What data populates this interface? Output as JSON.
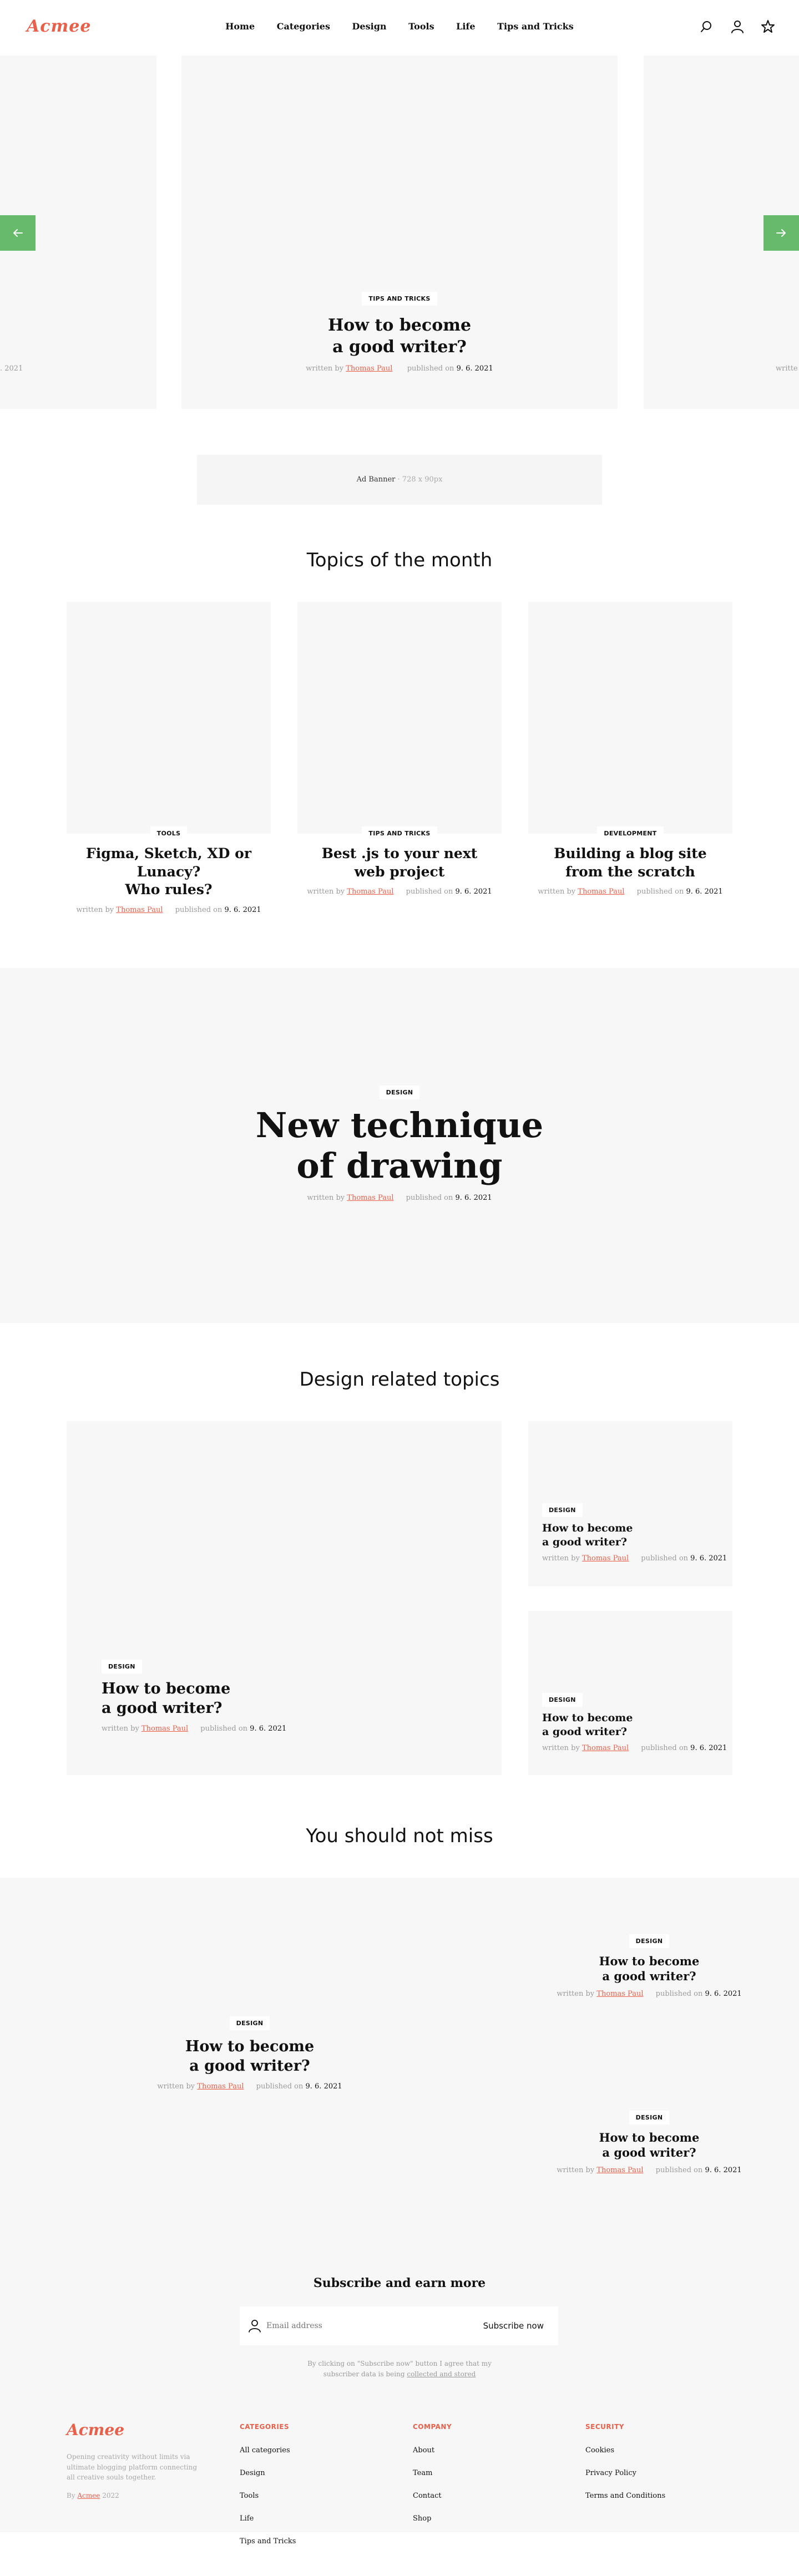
{
  "header": {
    "logo": "Acmee",
    "nav": [
      "Home",
      "Categories",
      "Design",
      "Tools",
      "Life",
      "Tips and Tricks"
    ]
  },
  "hero": {
    "tag": "TIPS AND TRICKS",
    "title_line1": "How to become",
    "title_line2": "a good writer?",
    "written_by": "written by",
    "author": "Thomas Paul",
    "published_on": "published on",
    "date": "9. 6. 2021",
    "left_peek_date": ". 2021",
    "right_peek": "writte"
  },
  "ad": {
    "label": "Ad Banner",
    "size": "728 x 90px"
  },
  "topics": {
    "title": "Topics of the month",
    "cards": [
      {
        "tag": "TOOLS",
        "title_line1": "Figma, Sketch, XD or Lunacy?",
        "title_line2": "Who rules?",
        "written_by": "written by",
        "author": "Thomas Paul",
        "published_on": "published on",
        "date": "9. 6. 2021"
      },
      {
        "tag": "TIPS AND TRICKS",
        "title_line1": "Best .js to your next",
        "title_line2": "web project",
        "written_by": "written by",
        "author": "Thomas Paul",
        "published_on": "published on",
        "date": "9. 6. 2021"
      },
      {
        "tag": "DEVELOPMENT",
        "title_line1": "Building a blog site",
        "title_line2": "from the scratch",
        "written_by": "written by",
        "author": "Thomas Paul",
        "published_on": "published on",
        "date": "9. 6. 2021"
      }
    ]
  },
  "feature": {
    "tag": "DESIGN",
    "title_line1": "New technique",
    "title_line2": "of drawing",
    "written_by": "written by",
    "author": "Thomas Paul",
    "published_on": "published on",
    "date": "9. 6. 2021"
  },
  "design_topics": {
    "title": "Design related topics",
    "main": {
      "tag": "DESIGN",
      "title_line1": "How to become",
      "title_line2": "a good writer?",
      "written_by": "written by",
      "author": "Thomas Paul",
      "published_on": "published on",
      "date": "9. 6. 2021"
    },
    "side": [
      {
        "tag": "DESIGN",
        "title_line1": "How to become",
        "title_line2": "a good writer?",
        "written_by": "written by",
        "author": "Thomas Paul",
        "published_on": "published on",
        "date": "9. 6. 2021"
      },
      {
        "tag": "DESIGN",
        "title_line1": "How to become",
        "title_line2": "a good writer?",
        "written_by": "written by",
        "author": "Thomas Paul",
        "published_on": "published on",
        "date": "9. 6. 2021"
      }
    ]
  },
  "miss": {
    "title": "You should not miss",
    "items": [
      {
        "tag": "DESIGN",
        "title_line1": "How to become",
        "title_line2": "a good writer?",
        "written_by": "written by",
        "author": "Thomas Paul",
        "published_on": "published on",
        "date": "9. 6. 2021"
      },
      {
        "tag": "DESIGN",
        "title_line1": "How to become",
        "title_line2": "a good writer?",
        "written_by": "written by",
        "author": "Thomas Paul",
        "published_on": "published on",
        "date": "9. 6. 2021"
      },
      {
        "tag": "DESIGN",
        "title_line1": "How to become",
        "title_line2": "a good writer?",
        "written_by": "written by",
        "author": "Thomas Paul",
        "published_on": "published on",
        "date": "9. 6. 2021"
      }
    ]
  },
  "subscribe": {
    "title": "Subscribe and earn more",
    "placeholder": "Email address",
    "button": "Subscribe now",
    "note_line1": "By clicking on \"Subscribe now\" button I agree that my",
    "note_line2_prefix": "subscriber data is being",
    "note_link": "collected and stored"
  },
  "footer": {
    "logo": "Acmee",
    "desc_line1": "Opening creativity without limits via",
    "desc_line2": "ultimate blogging platform connecting",
    "desc_line3": "all creative souls together.",
    "by_prefix": "By",
    "by_name": "Acmee",
    "year": "2022",
    "columns": [
      {
        "title": "CATEGORIES",
        "links": [
          "All categories",
          "Design",
          "Tools",
          "Life",
          "Tips and Tricks"
        ]
      },
      {
        "title": "COMPANY",
        "links": [
          "About",
          "Team",
          "Contact",
          "Shop"
        ]
      },
      {
        "title": "SECURITY",
        "links": [
          "Cookies",
          "Privacy Policy",
          "Terms and Conditions"
        ]
      }
    ]
  },
  "colors": {
    "accent": "#e9604a",
    "arrow": "#67ba6b",
    "panel": "#f7f7f7"
  }
}
